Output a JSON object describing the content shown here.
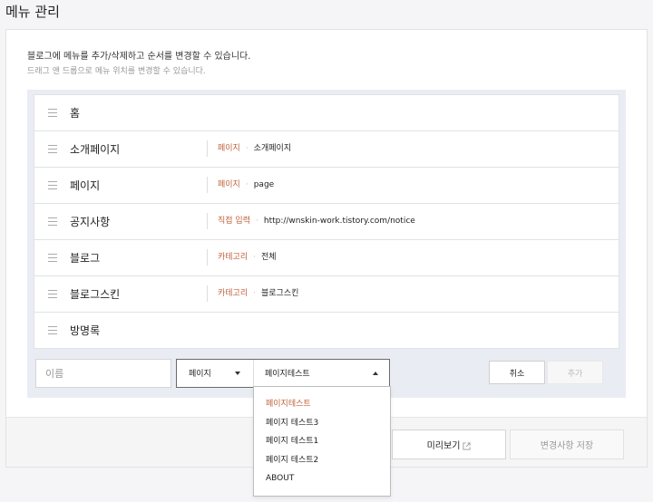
{
  "page": {
    "title": "메뉴 관리"
  },
  "description": {
    "line1": "블로그에 메뉴를 추가/삭제하고 순서를 변경할 수 있습니다.",
    "line2": "드래그 앤 드롭으로 메뉴 위치를 변경할 수 있습니다."
  },
  "menu_items": [
    {
      "name": "홈",
      "type": "",
      "target": ""
    },
    {
      "name": "소개페이지",
      "type": "페이지",
      "target": "소개페이지"
    },
    {
      "name": "페이지",
      "type": "페이지",
      "target": "page"
    },
    {
      "name": "공지사항",
      "type": "직접 입력",
      "target": "http://wnskin-work.tistory.com/notice"
    },
    {
      "name": "블로그",
      "type": "카테고리",
      "target": "전체"
    },
    {
      "name": "블로그스킨",
      "type": "카테고리",
      "target": "블로그스킨"
    },
    {
      "name": "방명록",
      "type": "",
      "target": ""
    }
  ],
  "add_form": {
    "name_placeholder": "이름",
    "type_value": "페이지",
    "target_value": "페이지테스트",
    "cancel_label": "취소",
    "add_label": "추가"
  },
  "dropdown": {
    "options": [
      "페이지테스트",
      "페이지 테스트3",
      "페이지 테스트1",
      "페이지 테스트2",
      "ABOUT"
    ],
    "selected": "페이지테스트"
  },
  "footer": {
    "preview_label": "미리보기",
    "save_label": "변경사항 저장"
  },
  "colors": {
    "accent": "#c0613c",
    "panel_background": "#e9ecf2",
    "page_background": "#f5f5f7"
  },
  "icons": {
    "drag_handle": "drag-handle-icon",
    "external_link": "external-link-icon",
    "caret_down": "chevron-down-icon",
    "caret_up": "chevron-up-icon"
  }
}
